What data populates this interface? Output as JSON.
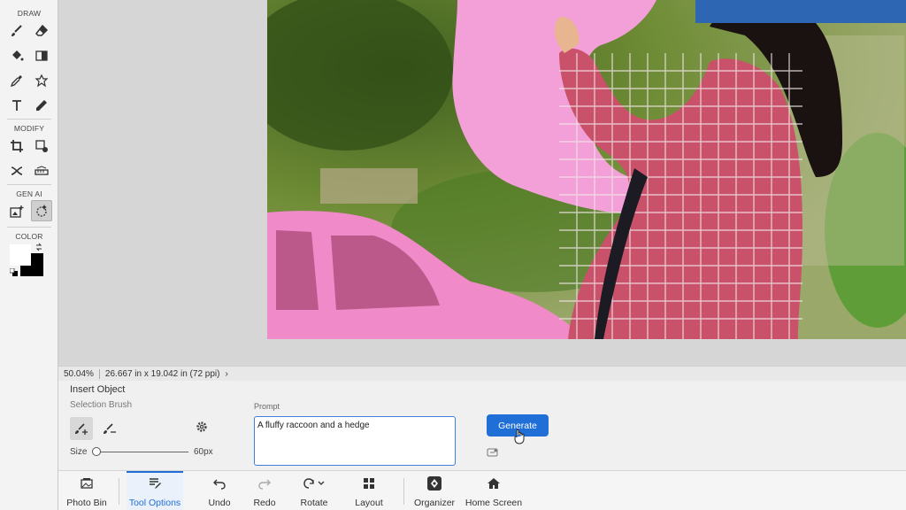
{
  "toolbox": {
    "sections": {
      "draw": "DRAW",
      "modify": "MODIFY",
      "gen_ai": "GEN AI",
      "color": "COLOR"
    },
    "tools": [
      {
        "name": "brush-tool",
        "icon": "brush-icon"
      },
      {
        "name": "eraser-tool",
        "icon": "eraser-icon"
      },
      {
        "name": "paint-bucket-tool",
        "icon": "paint-bucket-icon"
      },
      {
        "name": "gradient-tool",
        "icon": "gradient-icon"
      },
      {
        "name": "eyedropper-tool",
        "icon": "eyedropper-icon"
      },
      {
        "name": "custom-shape-tool",
        "icon": "custom-shape-icon"
      },
      {
        "name": "type-tool",
        "icon": "type-icon"
      },
      {
        "name": "pencil-tool",
        "icon": "pencil-icon"
      },
      {
        "name": "crop-tool",
        "icon": "crop-icon"
      },
      {
        "name": "recompose-tool",
        "icon": "recompose-icon"
      },
      {
        "name": "content-aware-move-tool",
        "icon": "move-arrows-icon"
      },
      {
        "name": "straighten-tool",
        "icon": "straighten-icon"
      },
      {
        "name": "generative-fill-tool",
        "icon": "generative-fill-icon"
      },
      {
        "name": "insert-object-tool",
        "icon": "lasso-sparkle-icon",
        "active": true
      }
    ],
    "colors": {
      "foreground": "#ffffff",
      "background": "#000000"
    }
  },
  "status": {
    "zoom": "50.04%",
    "doc_size": "26.667 in x 19.042 in (72 ppi)"
  },
  "options": {
    "title": "Insert Object",
    "subtitle": "Selection Brush",
    "size_label": "Size",
    "size_value": "60px",
    "size_fraction": 0.0,
    "prompt_label": "Prompt",
    "prompt_value": "A fluffy raccoon and a hedge",
    "generate_label": "Generate"
  },
  "bottom_bar": {
    "photo_bin": "Photo Bin",
    "tool_options": "Tool Options",
    "undo": "Undo",
    "redo": "Redo",
    "rotate": "Rotate",
    "layout": "Layout",
    "organizer": "Organizer",
    "home_screen": "Home Screen"
  },
  "colors": {
    "accent": "#1f6fd6",
    "selection_overlay": "#ff80c8"
  }
}
